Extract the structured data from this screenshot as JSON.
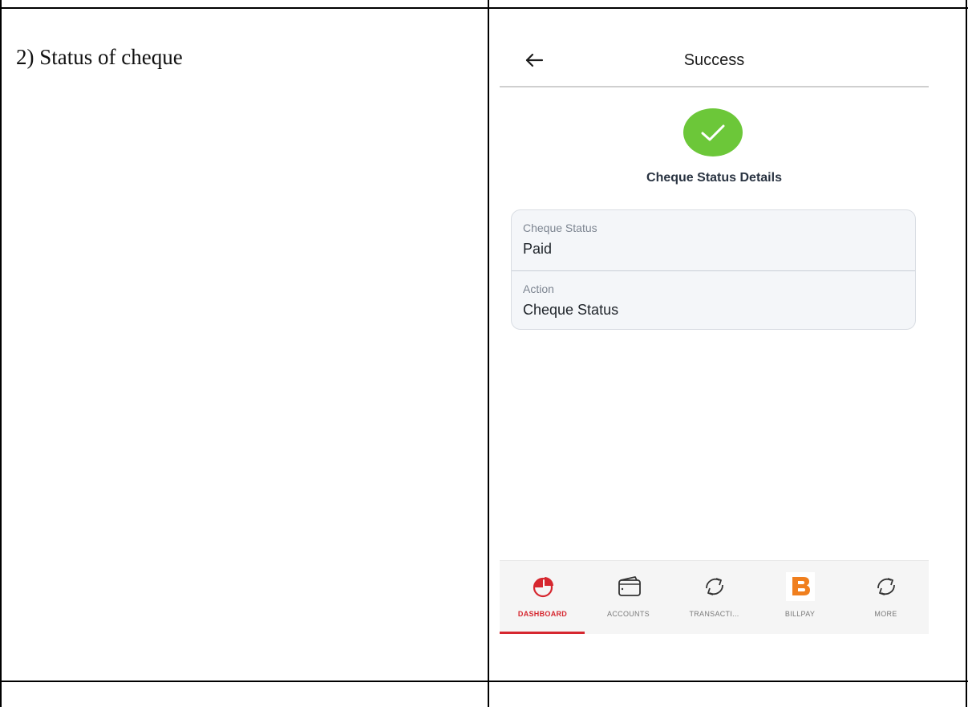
{
  "caption": "2) Status of cheque",
  "appbar": {
    "title": "Success"
  },
  "details_heading": "Cheque Status Details",
  "details": [
    {
      "label": "Cheque Status",
      "value": "Paid"
    },
    {
      "label": "Action",
      "value": "Cheque Status"
    }
  ],
  "bottom_nav": {
    "active_index": 0,
    "items": [
      {
        "label": "DASHBOARD",
        "icon": "dashboard-pie-icon"
      },
      {
        "label": "ACCOUNTS",
        "icon": "wallet-icon"
      },
      {
        "label": "TRANSACTI...",
        "icon": "transactions-arrows-icon"
      },
      {
        "label": "BILLPAY",
        "icon": "billpay-b-icon"
      },
      {
        "label": "MORE",
        "icon": "more-arrows-icon"
      }
    ]
  },
  "colors": {
    "success_green": "#6cc739",
    "accent_red": "#d6272f",
    "billpay_orange": "#f07f1e"
  }
}
